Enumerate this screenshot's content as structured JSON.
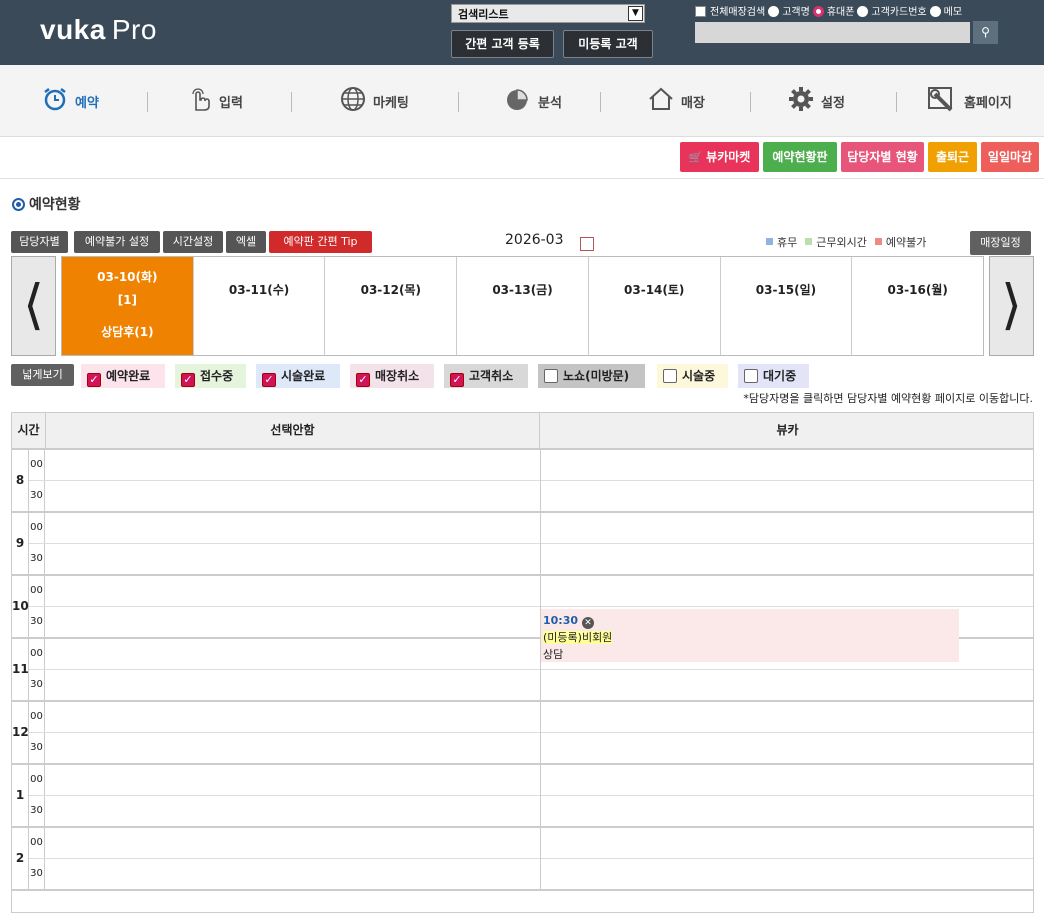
{
  "app": {
    "logo_main": "vuka",
    "logo_suffix": "Pro"
  },
  "top": {
    "search_type_selected": "검색리스트",
    "quick_register_label": "간편 고객 등록",
    "unregistered_label": "미등록 고객",
    "search_options": [
      {
        "label": "전체매장검색",
        "kind": "checkbox",
        "checked": false
      },
      {
        "label": "고객명",
        "kind": "radio",
        "checked": false
      },
      {
        "label": "휴대폰",
        "kind": "radio",
        "checked": true
      },
      {
        "label": "고객카드번호",
        "kind": "radio",
        "checked": false
      },
      {
        "label": "메모",
        "kind": "radio",
        "checked": false
      }
    ],
    "search_value": "",
    "search_icon": "search-icon"
  },
  "nav": [
    {
      "label": "예약",
      "icon": "alarm-clock-icon",
      "active": true
    },
    {
      "label": "입력",
      "icon": "pointing-hand-icon",
      "active": false
    },
    {
      "label": "마케팅",
      "icon": "globe-icon",
      "active": false
    },
    {
      "label": "분석",
      "icon": "pie-chart-icon",
      "active": false
    },
    {
      "label": "매장",
      "icon": "house-icon",
      "active": false
    },
    {
      "label": "설정",
      "icon": "gear-icon",
      "active": false
    },
    {
      "label": "홈페이지",
      "icon": "tools-icon",
      "active": false
    }
  ],
  "actions": [
    {
      "label": "뷰카마켓",
      "color": "#e8345a",
      "icon": "cart-icon"
    },
    {
      "label": "예약현황판",
      "color": "#4cae4c"
    },
    {
      "label": "담당자별 현황",
      "color": "#e8557a"
    },
    {
      "label": "출퇴근",
      "color": "#f0a000"
    },
    {
      "label": "일일마감",
      "color": "#ee5f5b"
    }
  ],
  "section_title": "예약현황",
  "toolbar": {
    "buttons": [
      "담당자별",
      "예약불가 설정",
      "시간설정",
      "엑셀"
    ],
    "tip_label": "예약판 간편 Tip",
    "month": "2026-03",
    "legend": [
      {
        "label": "휴무",
        "color": "#8fb4e3"
      },
      {
        "label": "근무외시간",
        "color": "#b8e0a8"
      },
      {
        "label": "예약불가",
        "color": "#f08a80"
      }
    ],
    "store_schedule_label": "매장일정"
  },
  "week": {
    "prev": "⟨",
    "next": "⟩",
    "days": [
      {
        "date": "03-10(화)",
        "count": "[1]",
        "sub": "상담후(1)",
        "selected": true
      },
      {
        "date": "03-11(수)",
        "count": "",
        "sub": "",
        "selected": false
      },
      {
        "date": "03-12(목)",
        "count": "",
        "sub": "",
        "selected": false
      },
      {
        "date": "03-13(금)",
        "count": "",
        "sub": "",
        "selected": false
      },
      {
        "date": "03-14(토)",
        "count": "",
        "sub": "",
        "selected": false
      },
      {
        "date": "03-15(일)",
        "count": "",
        "sub": "",
        "selected": false
      },
      {
        "date": "03-16(월)",
        "count": "",
        "sub": "",
        "selected": false
      }
    ]
  },
  "filters": {
    "wide_view_label": "넓게보기",
    "items": [
      {
        "label": "예약완료",
        "checked": true,
        "bg": "#fde4ec"
      },
      {
        "label": "접수중",
        "checked": true,
        "bg": "#e5f4dc"
      },
      {
        "label": "시술완료",
        "checked": true,
        "bg": "#dde8f8"
      },
      {
        "label": "매장취소",
        "checked": true,
        "bg": "#f4e2ea"
      },
      {
        "label": "고객취소",
        "checked": true,
        "bg": "#d8d8d8"
      },
      {
        "label": "노쇼(미방문)",
        "checked": false,
        "bg": "#c4c4c4"
      },
      {
        "label": "시술중",
        "checked": false,
        "bg": "#fdf8dc"
      },
      {
        "label": "대기중",
        "checked": false,
        "bg": "#e4e4f8"
      }
    ],
    "hint": "*담당자명을 클릭하면 담당자별 예약현황 페이지로 이동합니다."
  },
  "schedule": {
    "time_header": "시간",
    "columns": [
      "선택안함",
      "뷰카"
    ],
    "hours": [
      "8",
      "9",
      "10",
      "11",
      "12",
      "1",
      "2"
    ],
    "minutes": [
      "00",
      "30"
    ],
    "appointment": {
      "time": "10:30",
      "name": "(미등록)비회원",
      "note": "상담"
    }
  }
}
